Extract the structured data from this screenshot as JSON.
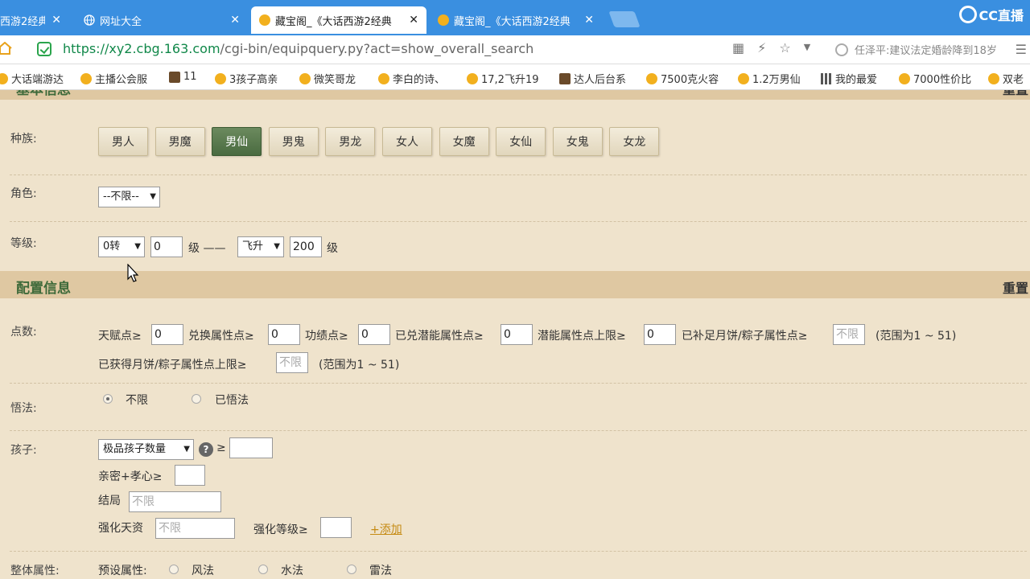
{
  "browser": {
    "tabs": [
      {
        "title": "西游2经典",
        "active": false
      },
      {
        "title": "网址大全",
        "active": false
      },
      {
        "title": "藏宝阁_《大话西游2经典",
        "active": true
      },
      {
        "title": "藏宝阁_《大话西游2经典",
        "active": false
      }
    ],
    "close_glyph": "✕",
    "brand": "CC直播",
    "url_scheme_host": "https://xy2.cbg.163.com",
    "url_path": "/cgi-bin/equipquery.py?act=show_overall_search",
    "news": "任泽平:建议法定婚龄降到18岁",
    "bookmarks": [
      {
        "label": "大话端游达",
        "icon": "c"
      },
      {
        "label": "主播公会服",
        "icon": "c"
      },
      {
        "label": "11",
        "icon": "sq"
      },
      {
        "label": "3孩子高亲",
        "icon": "c"
      },
      {
        "label": "微笑哥龙",
        "icon": "c"
      },
      {
        "label": "李白的诗、",
        "icon": "c"
      },
      {
        "label": "17,2飞升19",
        "icon": "c"
      },
      {
        "label": "达人后台系",
        "icon": "sq"
      },
      {
        "label": "7500克火容",
        "icon": "c"
      },
      {
        "label": "1.2万男仙",
        "icon": "c"
      },
      {
        "label": "我的最爱",
        "icon": "grid"
      },
      {
        "label": "7000性价比",
        "icon": "c"
      },
      {
        "label": "双老",
        "icon": "c"
      }
    ]
  },
  "basic": {
    "title": "基本信息",
    "reset": "重置",
    "race_label": "种族:",
    "races": [
      "男人",
      "男魔",
      "男仙",
      "男鬼",
      "男龙",
      "女人",
      "女魔",
      "女仙",
      "女鬼",
      "女龙"
    ],
    "selected_race": "男仙",
    "role_label": "角色:",
    "role_value": "--不限--",
    "level_label": "等级:",
    "level_from_select": "0转",
    "level_from": "0",
    "level_unit": "级 ——",
    "level_to_select": "飞升",
    "level_to": "200",
    "level_unit2": "级"
  },
  "config": {
    "title": "配置信息",
    "reset": "重置",
    "points_label": "点数:",
    "talent": "天赋点≥",
    "talent_value": "0",
    "exchange": "兑换属性点≥",
    "exchange_value": "0",
    "merit": "功绩点≥",
    "merit_value": "0",
    "potential": "已兑潜能属性点≥",
    "potential_value": "0",
    "potential_cap": "潜能属性点上限≥",
    "potential_cap_value": "0",
    "mooncake": "已补足月饼/粽子属性点≥",
    "mooncake_ph": "不限",
    "range1": "(范围为1 ~ 51)",
    "mooncake_cap": "已获得月饼/粽子属性点上限≥",
    "mooncake_cap_ph": "不限",
    "range2": "(范围为1 ~ 51)",
    "enlighten_label": "悟法:",
    "opt_any": "不限",
    "opt_enlightened": "已悟法",
    "child_label": "孩子:",
    "child_select": "极品孩子数量",
    "help": "?",
    "gte": "≥",
    "child_value": "",
    "intimacy": "亲密+孝心≥",
    "intimacy_value": "",
    "ending": "结局",
    "ending_ph": "不限",
    "talent_enh": "强化天资",
    "talent_enh_ph": "不限",
    "enh_level": "强化等级≥",
    "enh_level_value": "",
    "add": "+添加",
    "overall_label": "整体属性:",
    "preset": "预设属性:",
    "presets": [
      "风法",
      "水法",
      "雷法"
    ]
  }
}
